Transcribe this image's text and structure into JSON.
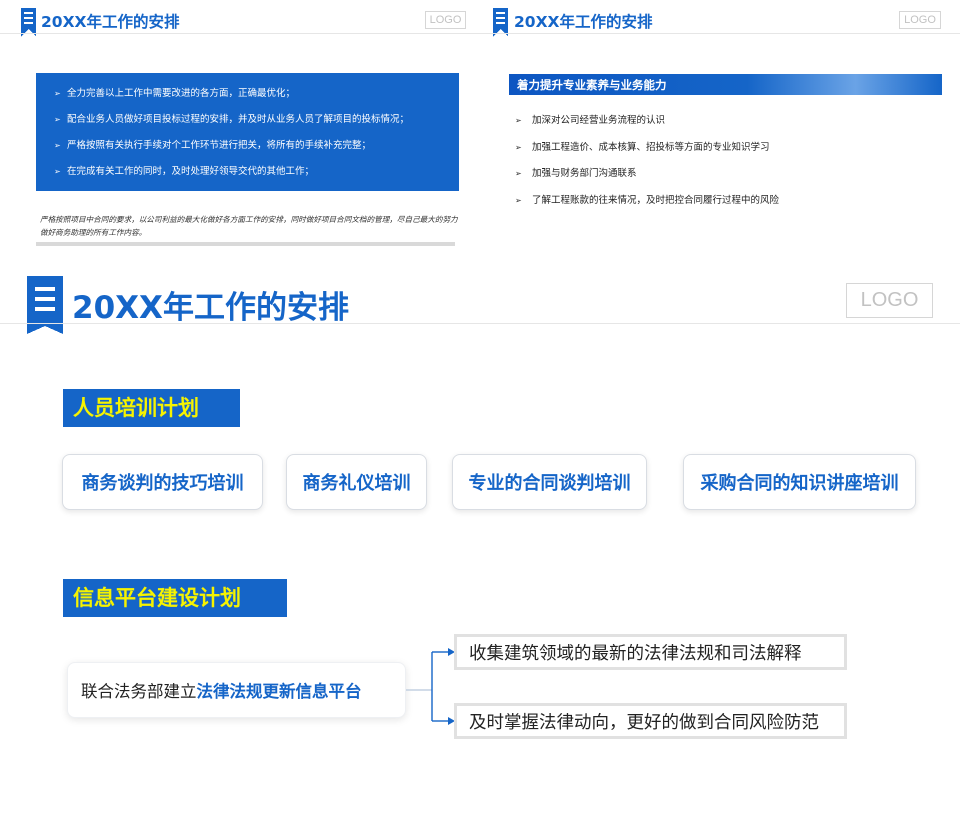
{
  "slide_top_left": {
    "title": "20XX年工作的安排",
    "logo": "LOGO",
    "items": [
      "全力完善以上工作中需要改进的各方面，正确最优化；",
      "配合业务人员做好项目投标过程的安排，并及时从业务人员了解项目的投标情况；",
      "严格按照有关执行手续对个工作环节进行把关，将所有的手续补充完整；",
      "在完成有关工作的同时，及时处理好领导交代的其他工作；"
    ],
    "note": "严格按照项目中合同的要求，以公司利益的最大化做好各方面工作的安排，同时做好项目合同文档的管理，尽自己最大的努力做好商务助理的所有工作内容。"
  },
  "slide_top_right": {
    "title": "20XX年工作的安排",
    "logo": "LOGO",
    "banner": "着力提升专业素养与业务能力",
    "items": [
      "加深对公司经营业务流程的认识",
      "加强工程造价、成本核算、招投标等方面的专业知识学习",
      "加强与财务部门沟通联系",
      "了解工程账款的往来情况，及时把控合同履行过程中的风险"
    ]
  },
  "slide_main": {
    "title": "20XX年工作的安排",
    "logo": "LOGO",
    "section1": {
      "label": "人员培训计划",
      "cards": [
        "商务谈判的技巧培训",
        "商务礼仪培训",
        "专业的合同谈判培训",
        "采购合同的知识讲座培训"
      ]
    },
    "section2": {
      "label": "信息平台建设计划",
      "source_prefix": "联合法务部建立",
      "source_highlight": "法律法规更新信息平台",
      "targets": [
        "收集建筑领域的最新的法律法规和司法解释",
        "及时掌握法律动向，更好的做到合同风险防范"
      ]
    }
  },
  "colors": {
    "accent": "#1565c8",
    "label_text": "#f6f300",
    "logo_border": "#d6d6d6"
  },
  "icons": {
    "list_bullet": "arrowhead-bullet-icon",
    "flow_arrow": "arrow-right-icon",
    "title_badge": "section-badge-icon"
  }
}
